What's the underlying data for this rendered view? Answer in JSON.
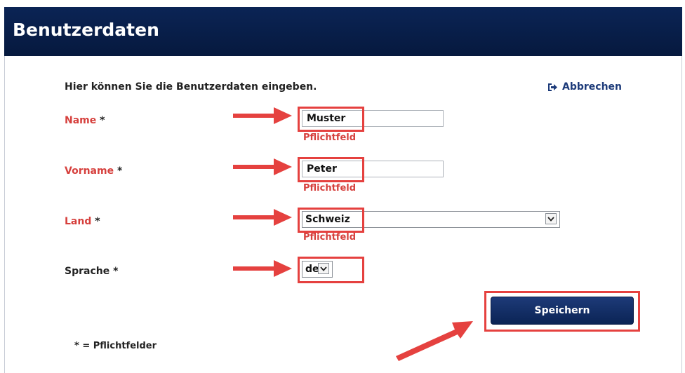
{
  "header": {
    "title": "Benutzerdaten"
  },
  "form": {
    "intro": "Hier können Sie die Benutzerdaten eingeben.",
    "cancel_label": "Abbrechen",
    "required_mark": "*",
    "fields": {
      "name": {
        "label": "Name",
        "value": "Muster",
        "error": "Pflichtfeld"
      },
      "vorname": {
        "label": "Vorname",
        "value": "Peter",
        "error": "Pflichtfeld"
      },
      "land": {
        "label": "Land",
        "value": "Schweiz",
        "error": "Pflichtfeld"
      },
      "sprache": {
        "label": "Sprache",
        "value": "de"
      }
    },
    "save_label": "Speichern",
    "legend": "* = Pflichtfelder"
  },
  "colors": {
    "header_bg": "#0b2455",
    "label_red": "#d6403d",
    "highlight_red": "#e5413f",
    "button_bg": "#1d3a78",
    "link_blue": "#1c3a79"
  },
  "icons": {
    "cancel": "sign-out-icon",
    "dropdown": "chevron-down-icon",
    "annotation": "arrow-icon"
  }
}
